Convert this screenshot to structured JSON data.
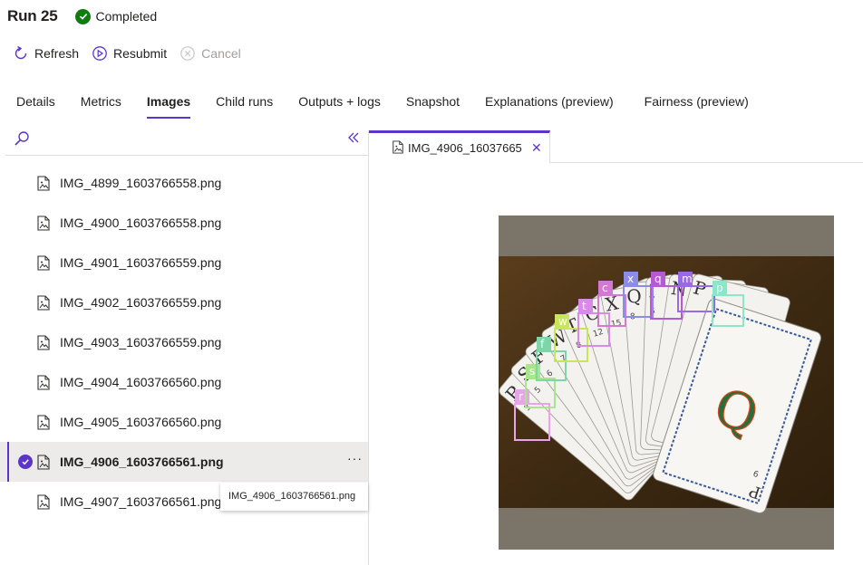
{
  "run": {
    "title": "Run 25",
    "status": "Completed"
  },
  "toolbar": {
    "refresh": "Refresh",
    "resubmit": "Resubmit",
    "cancel": "Cancel"
  },
  "tabs": [
    {
      "label": "Details"
    },
    {
      "label": "Metrics"
    },
    {
      "label": "Images"
    },
    {
      "label": "Child runs"
    },
    {
      "label": "Outputs + logs"
    },
    {
      "label": "Snapshot"
    },
    {
      "label": "Explanations (preview)"
    },
    {
      "label": "Fairness (preview)"
    }
  ],
  "active_tab": "Images",
  "files": [
    {
      "name": "IMG_4899_1603766558.png"
    },
    {
      "name": "IMG_4900_1603766558.png"
    },
    {
      "name": "IMG_4901_1603766559.png"
    },
    {
      "name": "IMG_4902_1603766559.png"
    },
    {
      "name": "IMG_4903_1603766559.png"
    },
    {
      "name": "IMG_4904_1603766560.png"
    },
    {
      "name": "IMG_4905_1603766560.png"
    },
    {
      "name": "IMG_4906_1603766561.png"
    },
    {
      "name": "IMG_4907_1603766561.png"
    }
  ],
  "selected_file": "IMG_4906_1603766561.png",
  "tooltip": "IMG_4906_1603766561.png",
  "open_tab": {
    "label": "IMG_4906_1603766561.png"
  },
  "image": {
    "cards": [
      {
        "letter": "R",
        "number": "3"
      },
      {
        "letter": "S",
        "number": "5"
      },
      {
        "letter": "F",
        "number": "6"
      },
      {
        "letter": "W",
        "number": "7"
      },
      {
        "letter": "T",
        "number": "8"
      },
      {
        "letter": "C",
        "number": "12"
      },
      {
        "letter": "X",
        "number": "15"
      },
      {
        "letter": "Q",
        "number": "8"
      },
      {
        "letter": "I",
        "number": "6"
      },
      {
        "letter": "N",
        "number": ""
      },
      {
        "letter": "P",
        "number": ""
      }
    ],
    "face_letter": "Q",
    "face_corner_letter": "P",
    "face_corner_number": "6",
    "detections": [
      {
        "label": "r",
        "color": "#e6a6e6"
      },
      {
        "label": "s",
        "color": "#a8e68c"
      },
      {
        "label": "f",
        "color": "#7ed6a8"
      },
      {
        "label": "w",
        "color": "#c8e65a"
      },
      {
        "label": "t",
        "color": "#d68ce6"
      },
      {
        "label": "c",
        "color": "#d27ad2"
      },
      {
        "label": "x",
        "color": "#8c8ce6"
      },
      {
        "label": "q",
        "color": "#b45ad2"
      },
      {
        "label": "m",
        "color": "#9a6ae6"
      },
      {
        "label": "p",
        "color": "#8ce6c8"
      }
    ]
  },
  "colors": {
    "accent": "#5b35c9",
    "success": "#107c10"
  }
}
